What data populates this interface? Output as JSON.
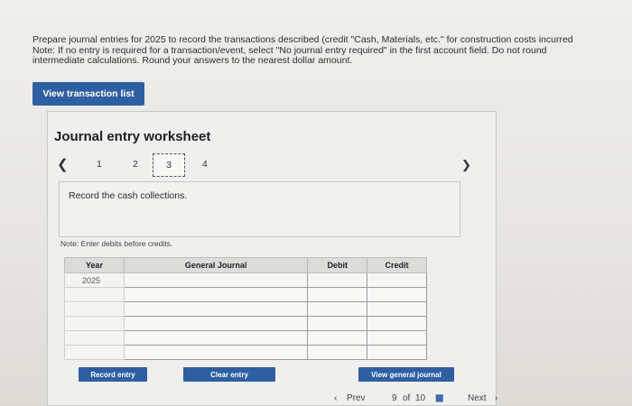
{
  "instructions": {
    "line1": "Prepare journal entries for 2025 to record the transactions described (credit \"Cash, Materials, etc.\" for construction costs incurred",
    "line2": "Note: If no entry is required for a transaction/event, select \"No journal entry required\" in the first account field. Do not round",
    "line3": "intermediate calculations. Round your answers to the nearest dollar amount."
  },
  "view_transaction_label": "View transaction list",
  "worksheet": {
    "title": "Journal entry worksheet",
    "nav": {
      "prev_icon": "chevron-left-icon",
      "next_icon": "chevron-right-icon",
      "pages": [
        "1",
        "2",
        "3",
        "4"
      ],
      "selected": "3"
    },
    "task_text": "Record the cash collections.",
    "note": "Note: Enter debits before credits.",
    "table": {
      "headers": {
        "year": "Year",
        "general_journal": "General Journal",
        "debit": "Debit",
        "credit": "Credit"
      },
      "first_year": "2025"
    },
    "buttons": {
      "record": "Record entry",
      "clear": "Clear entry",
      "view_journal": "View general journal"
    }
  },
  "footer": {
    "prev": "Prev",
    "page_current": "9",
    "page_of": "of",
    "page_total": "10",
    "next": "Next"
  },
  "colors": {
    "accent": "#2f5fa3"
  }
}
